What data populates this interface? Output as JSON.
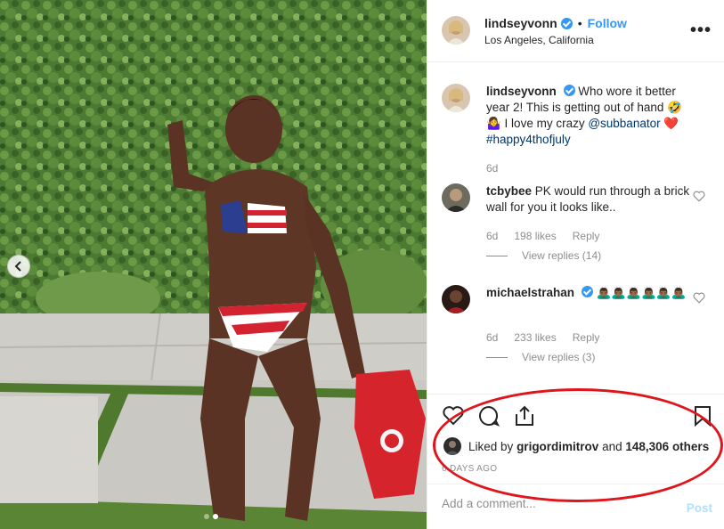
{
  "post": {
    "username": "lindseyvonn",
    "follow_label": "Follow",
    "separator": "•",
    "location": "Los Angeles, California",
    "more_label": "•••"
  },
  "caption": {
    "username": "lindseyvonn",
    "text_1": "Who wore it better year 2! This is getting out of hand 🤣 🤷‍♀️ I love my crazy ",
    "mention": "@subbanator",
    "text_2": " ❤️",
    "hashtag": "#happy4thofjuly",
    "age": "6d"
  },
  "comments": [
    {
      "username": "tcbybee",
      "text": "PK would run through a brick wall for you it looks like..",
      "age": "6d",
      "likes": "198 likes",
      "reply_label": "Reply",
      "view_replies": "View replies (14)"
    },
    {
      "username": "michaelstrahan",
      "text": "🙇🏾‍♂️🙇🏾‍♂️🙇🏾‍♂️🙇🏾‍♂️🙇🏾‍♂️🙇🏾‍♂️",
      "age": "6d",
      "likes": "233 likes",
      "reply_label": "Reply",
      "view_replies": "View replies (3)"
    }
  ],
  "likes": {
    "prefix": "Liked by",
    "user": "grigordimitrov",
    "middle": "and",
    "count": "148,306 others"
  },
  "date": "6 DAYS AGO",
  "comment_box": {
    "placeholder": "Add a comment...",
    "post_label": "Post"
  },
  "carousel": {
    "current": 2,
    "total": 2
  },
  "icons": [
    "chevron-left-icon",
    "heart-icon",
    "comment-icon",
    "share-icon",
    "bookmark-icon",
    "verified-icon",
    "more-icon"
  ],
  "colors": {
    "link": "#3897f0",
    "annotation": "#e0141b",
    "muted": "#8e8e8e"
  }
}
